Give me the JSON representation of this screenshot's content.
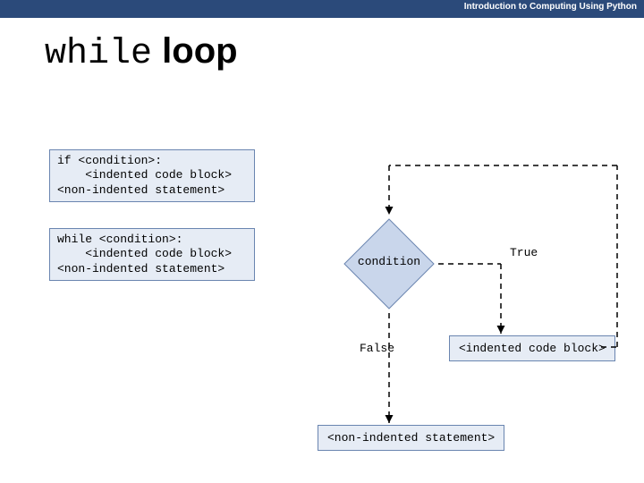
{
  "header": {
    "course": "Introduction to Computing Using Python"
  },
  "title": {
    "keyword": "while",
    "rest": " loop"
  },
  "code_boxes": {
    "if_box": "if <condition>:\n    <indented code block>\n<non-indented statement>",
    "while_box": "while <condition>:\n    <indented code block>\n<non-indented statement>"
  },
  "flow": {
    "condition_label": "condition",
    "true_label": "True",
    "false_label": "False",
    "true_branch_box": "<indented code block>",
    "end_box": "<non-indented statement>"
  },
  "colors": {
    "header_bg": "#2b4a7a",
    "box_fill": "#e6ecf5",
    "box_stroke": "#6a85b0",
    "diamond_fill": "#c9d6eb"
  }
}
